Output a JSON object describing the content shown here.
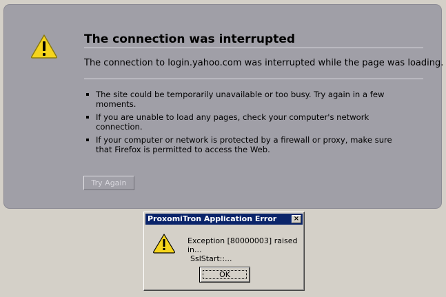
{
  "error_page": {
    "title": "The connection was interrupted",
    "description": "The connection to login.yahoo.com was interrupted while the page was loading.",
    "bullets": [
      "The site could be temporarily unavailable or too busy. Try again in a few moments.",
      "If you are unable to load any pages, check your computer's network connection.",
      "If your computer or network is protected by a firewall or proxy, make sure that Firefox is permitted to access the Web."
    ],
    "try_again_label": "Try Again",
    "icon": "warning-icon"
  },
  "dialog": {
    "title": "ProxomiTron Application Error",
    "close_label": "×",
    "message_line1": "Exception [80000003] raised in...",
    "message_line2": "SslStart::...",
    "ok_label": "OK",
    "icon": "warning-icon"
  },
  "colors": {
    "desktop": "#d4d0c8",
    "error_page_bg": "#a09fa7",
    "titlebar": "#0a246a",
    "warning_yellow": "#f5d41c"
  }
}
